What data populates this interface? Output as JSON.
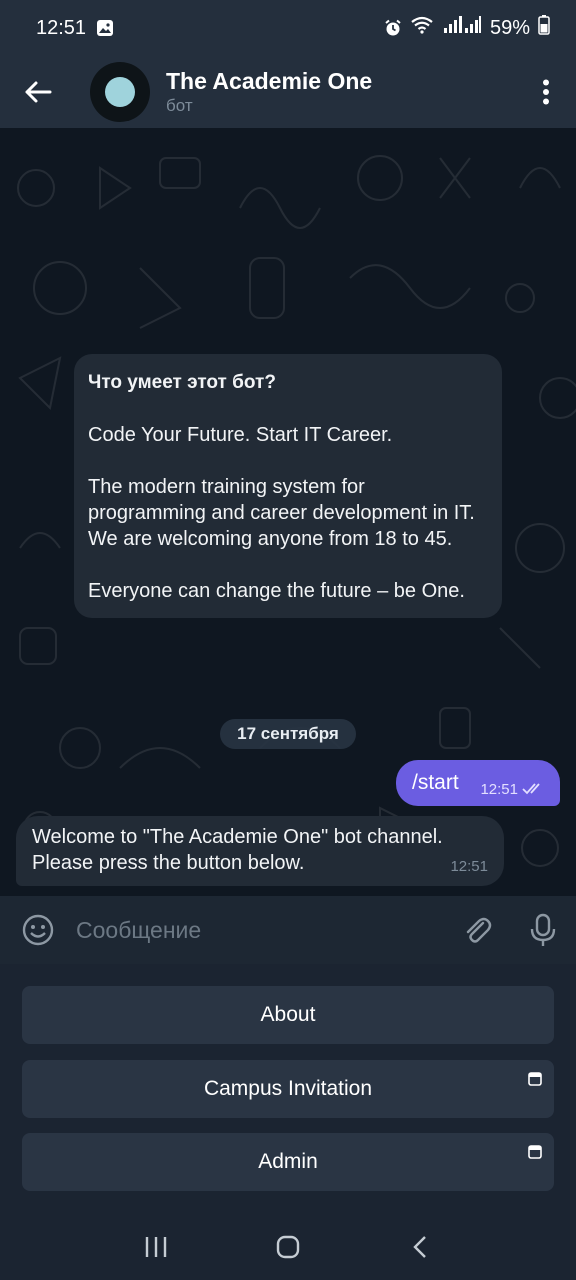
{
  "status_bar": {
    "time": "12:51",
    "battery": "59%"
  },
  "header": {
    "title": "The Academie One",
    "subtitle": "бот"
  },
  "info_card": {
    "title": "Что умеет этот бот?",
    "paragraphs": [
      "Code Your Future. Start IT Career.",
      "The modern training system for programming and career development in IT. We are welcoming anyone from 18 to 45.",
      "Everyone can change the future – be One."
    ]
  },
  "date_separator": "17 сентября",
  "messages": {
    "outgoing": {
      "text": "/start",
      "time": "12:51"
    },
    "incoming": {
      "text": "Welcome to \"The Academie One\" bot channel. Please press the button below.",
      "time": "12:51"
    }
  },
  "composer": {
    "placeholder": "Сообщение"
  },
  "keyboard": {
    "buttons": [
      {
        "label": "About",
        "webapp": false
      },
      {
        "label": "Campus Invitation",
        "webapp": true
      },
      {
        "label": "Admin",
        "webapp": true
      }
    ]
  },
  "colors": {
    "header_bg": "#242f3d",
    "chat_bg": "#0f1721",
    "bubble_in": "#222b36",
    "bubble_out": "#6b5de1",
    "keyboard_button": "#2a3544"
  },
  "icons": {
    "back": "arrow-left-icon",
    "menu": "more-vertical-icon",
    "emoji": "emoji-icon",
    "attach": "paperclip-icon",
    "mic": "microphone-icon",
    "read": "double-check-icon",
    "webapp": "window-icon",
    "nav_recents": "recents-icon",
    "nav_home": "home-icon",
    "nav_back": "chevron-left-icon"
  }
}
